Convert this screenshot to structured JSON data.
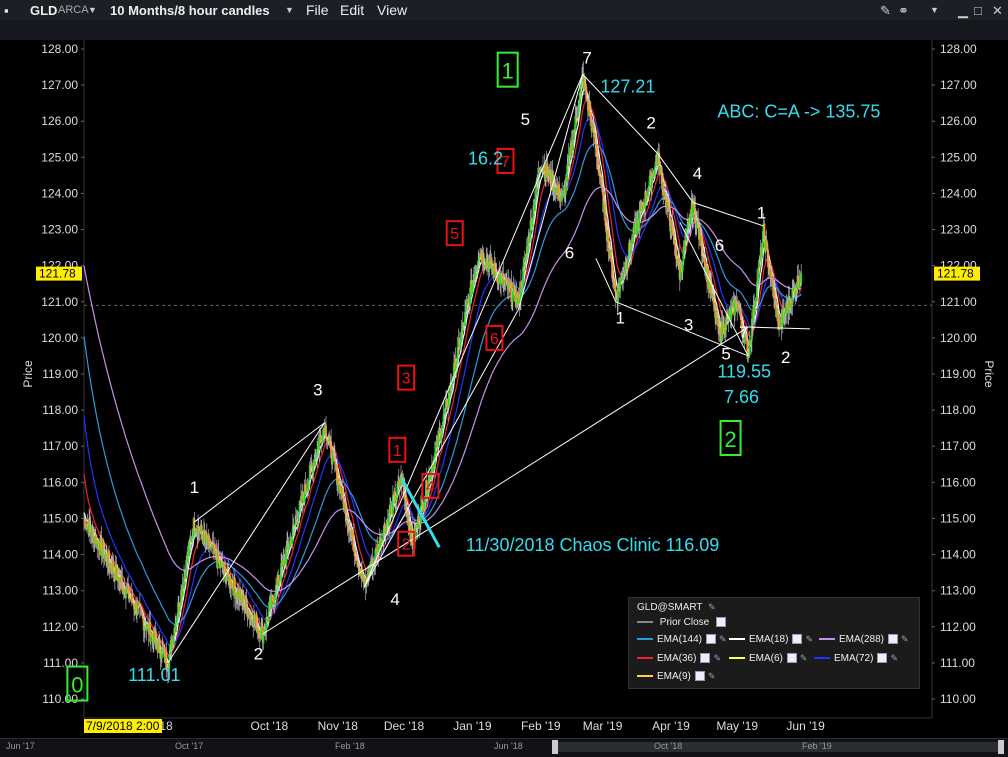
{
  "window": {
    "symbol": "GLD",
    "exchange": "ARCA",
    "timeframe": "10 Months/8 hour candles",
    "menus": [
      "File",
      "Edit",
      "View"
    ]
  },
  "colors": {
    "bg": "#000000",
    "up_candle": "#22dd22",
    "down_candle": "#ff9933",
    "wick": "#ffffff",
    "cyan_text": "#33ddee",
    "red_box": "#ee1111",
    "green_box": "#33ee33",
    "price_tag": "#ffee00",
    "wave_lines": "#ffffff"
  },
  "chart_data": {
    "type": "candlestick",
    "ylabel": "Price",
    "ylim": [
      110.0,
      128.0
    ],
    "y_ticks": [
      "128.00",
      "127.00",
      "126.00",
      "125.00",
      "124.00",
      "123.00",
      "122.00",
      "121.00",
      "120.00",
      "119.00",
      "118.00",
      "117.00",
      "116.00",
      "115.00",
      "114.00",
      "113.00",
      "112.00",
      "111.00",
      "110.00"
    ],
    "x_labels": [
      "7/9/2018 2:00",
      "18",
      "Oct '18",
      "Nov '18",
      "Dec '18",
      "Jan '19",
      "Feb '19",
      "Mar '19",
      "Apr '19",
      "May '19",
      "Jun '19"
    ],
    "x_label_dates": [
      "2018-07-09",
      null,
      "2018-10-01",
      "2018-11-01",
      "2018-12-01",
      "2019-01-01",
      "2019-02-01",
      "2019-03-01",
      "2019-04-01",
      "2019-05-01",
      "2019-06-01"
    ],
    "last_price": "121.78",
    "prior_close": 120.9,
    "key_points": [
      {
        "date": "2018-07-09",
        "price": 115.0
      },
      {
        "date": "2018-08-16",
        "price": 111.01
      },
      {
        "date": "2018-08-28",
        "price": 114.9
      },
      {
        "date": "2018-09-28",
        "price": 111.8
      },
      {
        "date": "2018-10-26",
        "price": 117.6
      },
      {
        "date": "2018-11-13",
        "price": 113.1
      },
      {
        "date": "2018-11-30",
        "price": 116.1
      },
      {
        "date": "2018-12-05",
        "price": 114.3
      },
      {
        "date": "2018-12-20",
        "price": 118.0
      },
      {
        "date": "2019-01-04",
        "price": 122.4
      },
      {
        "date": "2019-01-22",
        "price": 121.0
      },
      {
        "date": "2019-02-01",
        "price": 124.9
      },
      {
        "date": "2019-02-11",
        "price": 123.8
      },
      {
        "date": "2019-02-20",
        "price": 127.21
      },
      {
        "date": "2019-02-26",
        "price": 125.3
      },
      {
        "date": "2019-03-07",
        "price": 121.1
      },
      {
        "date": "2019-03-15",
        "price": 122.8
      },
      {
        "date": "2019-03-26",
        "price": 125.0
      },
      {
        "date": "2019-04-05",
        "price": 121.8
      },
      {
        "date": "2019-04-11",
        "price": 123.7
      },
      {
        "date": "2019-04-23",
        "price": 120.1
      },
      {
        "date": "2019-05-01",
        "price": 121.0
      },
      {
        "date": "2019-05-06",
        "price": 119.55
      },
      {
        "date": "2019-05-13",
        "price": 122.9
      },
      {
        "date": "2019-05-20",
        "price": 120.3
      },
      {
        "date": "2019-05-30",
        "price": 121.78
      }
    ],
    "ema_colors": {
      "EMA(9)": "#ffcc55",
      "EMA(6)": "#ffff55",
      "EMA(18)": "#ffffff",
      "EMA(36)": "#ee2233",
      "EMA(72)": "#2233ff",
      "EMA(144)": "#2a9adf",
      "EMA(288)": "#c890ee"
    },
    "wave_lines": [
      [
        [
          "2018-08-16",
          111.0
        ],
        [
          "2018-10-26",
          117.65
        ]
      ],
      [
        [
          "2018-08-28",
          114.9
        ],
        [
          "2018-10-26",
          117.65
        ]
      ],
      [
        [
          "2018-09-28",
          111.8
        ],
        [
          "2019-05-06",
          120.3
        ]
      ],
      [
        [
          "2019-05-06",
          120.3
        ],
        [
          "2019-06-03",
          120.25
        ]
      ],
      [
        [
          "2018-11-13",
          113.1
        ],
        [
          "2019-02-20",
          127.3
        ]
      ],
      [
        [
          "2018-11-13",
          113.1
        ],
        [
          "2019-01-22",
          120.8
        ]
      ],
      [
        [
          "2019-01-22",
          120.8
        ],
        [
          "2019-02-20",
          127.3
        ]
      ],
      [
        [
          "2019-02-20",
          127.3
        ],
        [
          "2019-03-26",
          125.1
        ]
      ],
      [
        [
          "2019-03-26",
          125.1
        ],
        [
          "2019-04-11",
          123.75
        ]
      ],
      [
        [
          "2019-04-11",
          123.75
        ],
        [
          "2019-05-13",
          123.1
        ]
      ],
      [
        [
          "2019-02-26",
          122.2
        ],
        [
          "2019-03-07",
          121.0
        ]
      ],
      [
        [
          "2019-03-07",
          121.0
        ],
        [
          "2019-05-06",
          119.5
        ]
      ],
      [
        [
          "2019-04-05",
          123.2
        ],
        [
          "2019-05-06",
          119.5
        ]
      ]
    ],
    "callout_line": [
      [
        "2018-11-30",
        116.1
      ],
      [
        "2018-12-17",
        114.2
      ]
    ],
    "annotations": {
      "white_labels": [
        {
          "text": "1",
          "date": "2018-08-28",
          "price": 115.7
        },
        {
          "text": "2",
          "date": "2018-09-26",
          "price": 111.1
        },
        {
          "text": "3",
          "date": "2018-10-23",
          "price": 118.4
        },
        {
          "text": "4",
          "date": "2018-11-27",
          "price": 112.6
        },
        {
          "text": "5",
          "date": "2019-01-25",
          "price": 125.9
        },
        {
          "text": "6",
          "date": "2019-02-14",
          "price": 122.2
        },
        {
          "text": "7",
          "date": "2019-02-22",
          "price": 127.6
        },
        {
          "text": "1",
          "date": "2019-03-09",
          "price": 120.4
        },
        {
          "text": "2",
          "date": "2019-03-23",
          "price": 125.8
        },
        {
          "text": "3",
          "date": "2019-04-09",
          "price": 120.2
        },
        {
          "text": "4",
          "date": "2019-04-13",
          "price": 124.4
        },
        {
          "text": "5",
          "date": "2019-04-26",
          "price": 119.4
        },
        {
          "text": "6",
          "date": "2019-04-23",
          "price": 122.4
        },
        {
          "text": "7",
          "date": "2019-05-04",
          "price": 120.0
        },
        {
          "text": "1",
          "date": "2019-05-12",
          "price": 123.3
        },
        {
          "text": "2",
          "date": "2019-05-23",
          "price": 119.3
        }
      ],
      "red_boxes": [
        {
          "text": "1",
          "date": "2018-11-28",
          "price": 116.9
        },
        {
          "text": "2",
          "date": "2018-12-02",
          "price": 114.3
        },
        {
          "text": "3",
          "date": "2018-12-02",
          "price": 118.9
        },
        {
          "text": "4",
          "date": "2018-12-13",
          "price": 115.9
        },
        {
          "text": "5",
          "date": "2018-12-24",
          "price": 122.9
        },
        {
          "text": "6",
          "date": "2019-01-11",
          "price": 120.0
        },
        {
          "text": "7",
          "date": "2019-01-16",
          "price": 124.9
        }
      ],
      "green_boxes": [
        {
          "text": "0",
          "date": "2018-07-06",
          "price": 110.4
        },
        {
          "text": "1",
          "date": "2019-01-17",
          "price": 127.4
        },
        {
          "text": "2",
          "date": "2019-04-28",
          "price": 117.2
        }
      ],
      "cyan_texts": [
        {
          "text": "111.01",
          "date": "2018-07-29",
          "price": 110.5
        },
        {
          "text": "127.21",
          "date": "2019-02-28",
          "price": 126.8
        },
        {
          "text": "16.2",
          "date": "2018-12-30",
          "price": 124.8
        },
        {
          "text": "ABC: C=A -> 135.75",
          "date": "2019-04-22",
          "price": 126.1
        },
        {
          "text": "119.55",
          "date": "2019-04-22",
          "price": 118.9
        },
        {
          "text": "7.66",
          "date": "2019-04-25",
          "price": 118.2
        },
        {
          "text": "11/30/2018 Chaos Clinic 116.09",
          "date": "2018-12-29",
          "price": 114.1
        }
      ]
    }
  },
  "legend": {
    "title": "GLD@SMART",
    "prior_close_label": "Prior Close",
    "items": [
      "EMA(144)",
      "EMA(18)",
      "EMA(288)",
      "EMA(36)",
      "EMA(6)",
      "EMA(72)",
      "EMA(9)"
    ]
  },
  "scrollbar_labels": [
    "Jun '17",
    "Oct '17",
    "Feb '18",
    "Jun '18",
    "Oct '18",
    "Feb '19"
  ]
}
